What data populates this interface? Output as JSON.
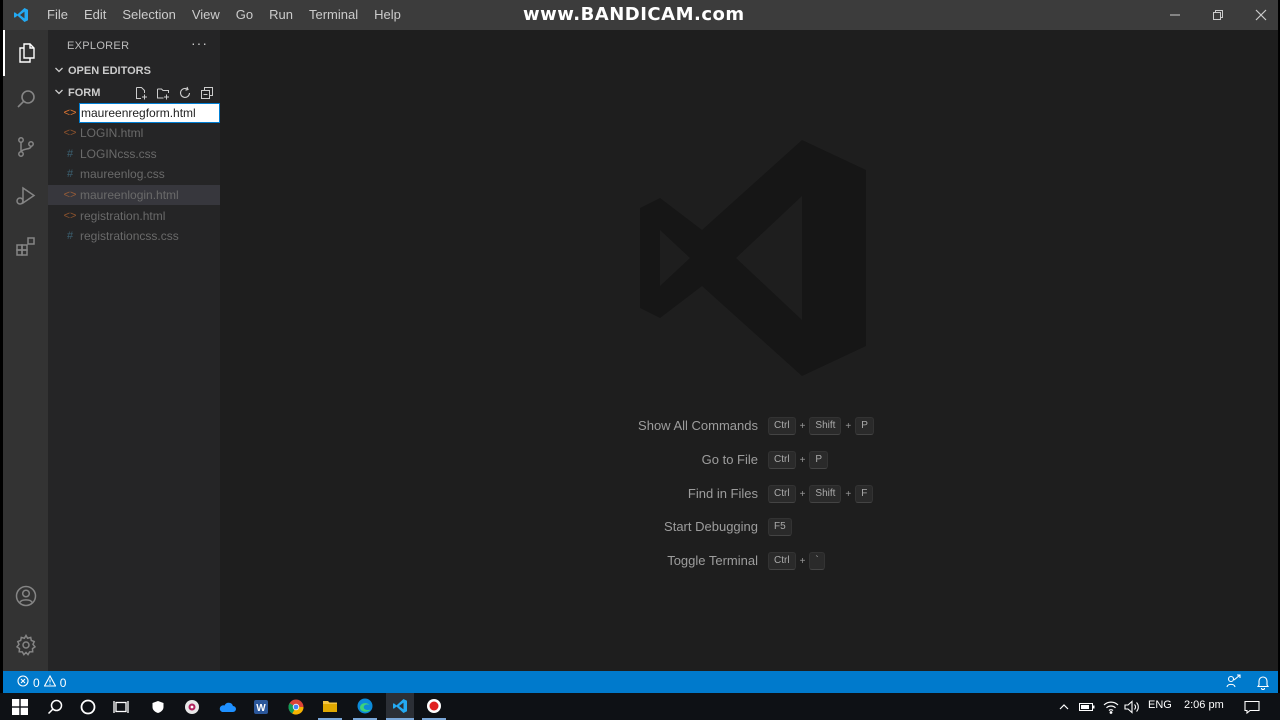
{
  "titlebar": {
    "menus": [
      "File",
      "Edit",
      "Selection",
      "View",
      "Go",
      "Run",
      "Terminal",
      "Help"
    ],
    "watermark": "www.BANDICAM.com"
  },
  "sidebar": {
    "title": "EXPLORER",
    "more": "···",
    "open_editors": "OPEN EDITORS",
    "folder": "FORM",
    "rename_value": "maureenregform.html",
    "files": [
      {
        "name": "LOGIN.html",
        "icon": "<>",
        "type": "html"
      },
      {
        "name": "LOGINcss.css",
        "icon": "#",
        "type": "css"
      },
      {
        "name": "maureenlog.css",
        "icon": "#",
        "type": "css"
      },
      {
        "name": "maureenlogin.html",
        "icon": "<>",
        "type": "html"
      },
      {
        "name": "registration.html",
        "icon": "<>",
        "type": "html"
      },
      {
        "name": "registrationcss.css",
        "icon": "#",
        "type": "css"
      }
    ]
  },
  "editor": {
    "shortcuts": [
      {
        "label": "Show All Commands",
        "keys": [
          "Ctrl",
          "Shift",
          "P"
        ]
      },
      {
        "label": "Go to File",
        "keys": [
          "Ctrl",
          "P"
        ]
      },
      {
        "label": "Find in Files",
        "keys": [
          "Ctrl",
          "Shift",
          "F"
        ]
      },
      {
        "label": "Start Debugging",
        "keys": [
          "F5"
        ]
      },
      {
        "label": "Toggle Terminal",
        "keys": [
          "Ctrl",
          "`"
        ]
      }
    ]
  },
  "statusbar": {
    "errors": "0",
    "warnings": "0"
  },
  "taskbar": {
    "language": "ENG",
    "time": "2:06 pm"
  },
  "colors": {
    "status_bar": "#007acc",
    "activity_bar": "#333333",
    "sidebar": "#252526",
    "editor": "#1e1e1e",
    "titlebar": "#3c3c3c",
    "input_focus_border": "#007fd4"
  }
}
